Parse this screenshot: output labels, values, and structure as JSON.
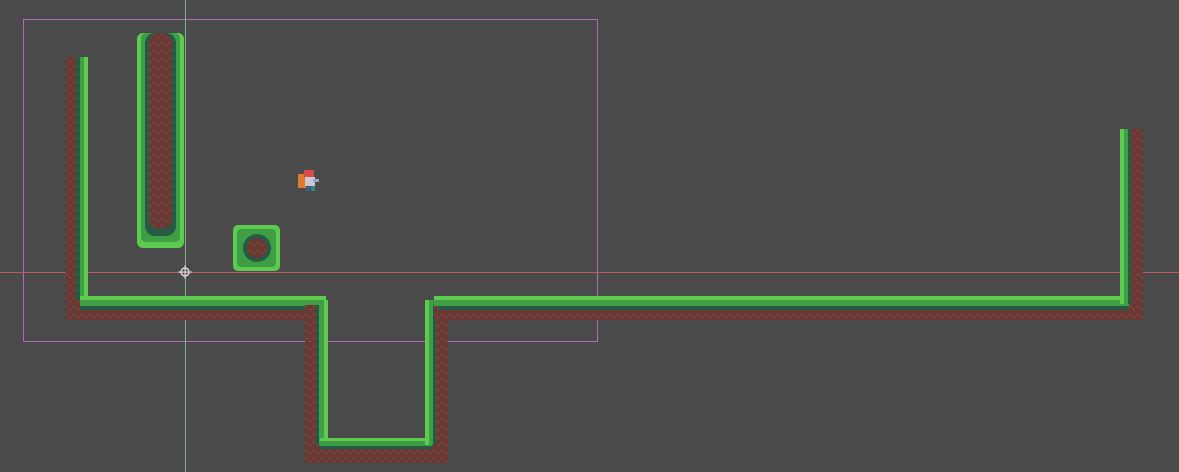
{
  "editor": {
    "view": "2d-scene-viewport",
    "background_color": "#4a4a4a"
  },
  "colors": {
    "dirt": "#6b3a34",
    "dirt_speck": "#8a4f47",
    "grass_light": "#5dcb4e",
    "grass_mid": "#3f9e45",
    "grass_dark": "#255a44",
    "camera_frame": "#b06ab8",
    "x_axis": "#c0566a",
    "y_axis": "#7fb37f"
  },
  "scene": {
    "tilemap_name": "terrain-tilemap",
    "player_sprite": "player-character-sprite",
    "origin_gizmo": "origin-crosshair-icon"
  }
}
